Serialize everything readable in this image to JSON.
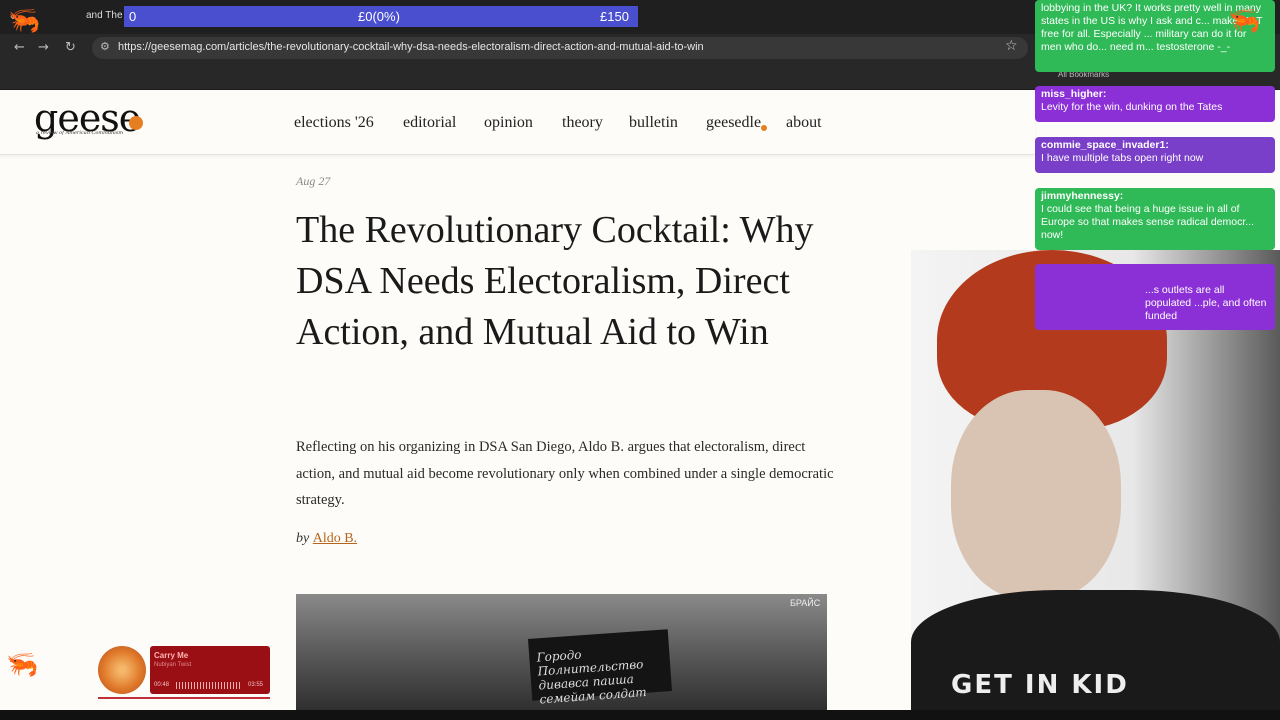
{
  "browser": {
    "tab_title": "and The",
    "url": "https://geesemag.com/articles/the-revolutionary-cocktail-why-dsa-needs-electoralism-direct-action-and-mutual-aid-to-win",
    "bookmarks_label": "All Bookmarks"
  },
  "donation": {
    "current": "0",
    "progress": "£0(0%)",
    "goal": "£150"
  },
  "site": {
    "logo": "geese",
    "logo_tagline": "a review of American Communism",
    "nav": [
      "elections '26",
      "editorial",
      "opinion",
      "theory",
      "bulletin",
      "geesedle",
      "about"
    ]
  },
  "article": {
    "date": "Aug 27",
    "title": "The Revolutionary Cocktail: Why DSA Needs Electoralism, Direct Action, and Mutual Aid to Win",
    "dek": "Reflecting on his organizing in DSA San Diego, Aldo B. argues that electoralism, direct action, and mutual aid become revolutionary only when combined under a single democratic strategy.",
    "byline_prefix": "by",
    "author": "Aldo B.",
    "photo_banner_text": "Городо Полнительство дивавса паиша семейам солдат",
    "photo_sign": "БРАЙС"
  },
  "chat": [
    {
      "user": "",
      "text": "lobbying in the UK? It works pretty well in many states in the US is why I ask and c... make HRT free for all. Especially ... military can do it for men who do... need m... testosterone -_-",
      "color": "#2fba57"
    },
    {
      "user": "miss_higher:",
      "text": "Levity for the win, dunking on the Tates",
      "color": "#8b2fd6"
    },
    {
      "user": "commie_space_invader1:",
      "text": "I have multiple tabs open right now",
      "color": "#7a3fc8"
    },
    {
      "user": "jimmyhennessy:",
      "text": "I could see that being a huge issue in all of Europe so that makes sense radical democr... now!",
      "color": "#2fba57"
    },
    {
      "user": "",
      "text": "...s outlets are all populated ...ple, and often funded",
      "color": "#8b2fd6"
    }
  ],
  "music": {
    "song": "Carry Me",
    "artist": "Nubiyan Twist",
    "elapsed": "00:48",
    "total": "03:55",
    "progress_fraction": 0.2
  },
  "cam": {
    "shirt_text": "GET IN KID"
  },
  "colors": {
    "donation_bar": "#4a4fcf",
    "accent_orange": "#e67e22",
    "author_link": "#b5651d",
    "chat_green": "#2fba57",
    "chat_purple": "#8b2fd6"
  }
}
